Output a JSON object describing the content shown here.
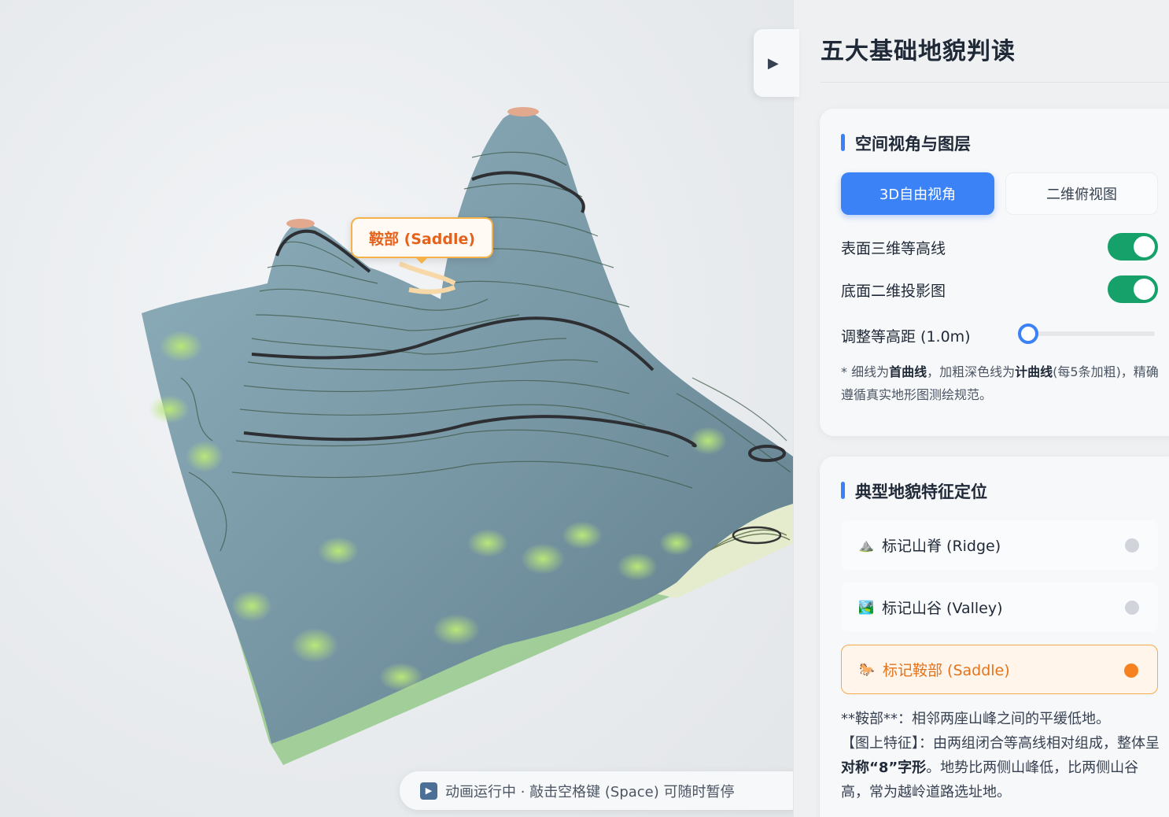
{
  "panel": {
    "title": "五大基础地貌判读",
    "collapse_icon": "▶"
  },
  "view_card": {
    "heading": "空间视角与图层",
    "view_3d_label": "3D自由视角",
    "view_2d_label": "二维俯视图",
    "surface_contour_label": "表面三维等高线",
    "surface_contour_on": true,
    "base_projection_label": "底面二维投影图",
    "base_projection_on": true,
    "interval_label": "调整等高距 (1.0m)",
    "interval_level": 0.0,
    "note_prefix": "* 细线为",
    "note_term1": "首曲线",
    "note_mid": "，加粗深色线为",
    "note_term2": "计曲线",
    "note_suffix": "(每5条加粗)，精确遵循真实地形图测绘规范。"
  },
  "feature_card": {
    "heading": "典型地貌特征定位",
    "items": [
      {
        "emoji": "⛰️",
        "label": "标记山脊 (Ridge)",
        "active": false
      },
      {
        "emoji": "🏞️",
        "label": "标记山谷 (Valley)",
        "active": false
      },
      {
        "emoji": "🐎",
        "label": "标记鞍部 (Saddle)",
        "active": true
      }
    ],
    "desc_line1": "**鞍部**：相邻两座山峰之间的平缓低地。",
    "desc_line2_a": "【图上特征】：由两组闭合等高线相对组成，整体呈",
    "desc_line2_b": "对称“8”字形",
    "desc_line2_c": "。地势比两侧山峰低，比两侧山谷高，常为越岭道路选址地。"
  },
  "scene": {
    "marker_label": "鞍部 (Saddle)",
    "status_text": "动画运行中 · 敲击空格键 (Space) 可随时暂停",
    "status_icon": "play-icon"
  },
  "colors": {
    "accent": "#3b82f6",
    "toggle_on": "#16a06a",
    "highlight": "#f5821f",
    "terrain": "#7f9aa8",
    "grass": "#b5e08a"
  }
}
